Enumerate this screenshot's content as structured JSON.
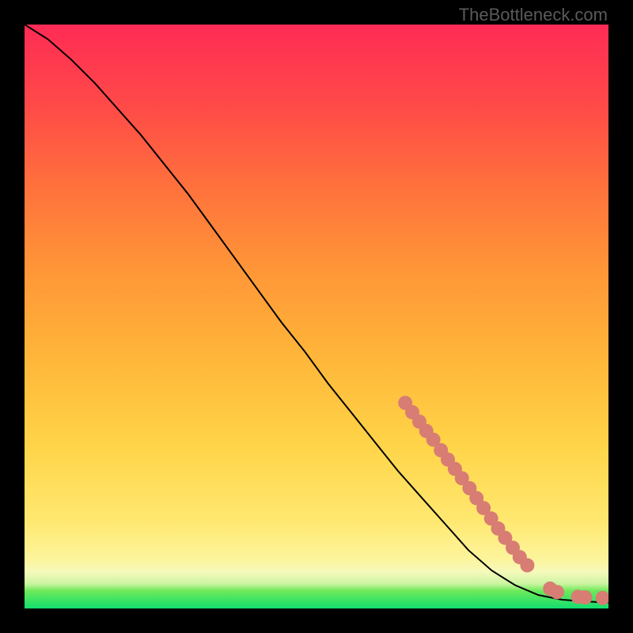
{
  "watermark": "TheBottleneck.com",
  "colors": {
    "curve": "#000000",
    "marker_fill": "#d77d74",
    "marker_stroke": "#d77d74"
  },
  "chart_data": {
    "type": "line",
    "title": "",
    "xlabel": "",
    "ylabel": "",
    "xlim": [
      0,
      100
    ],
    "ylim": [
      0,
      100
    ],
    "grid": false,
    "legend": false,
    "series": [
      {
        "name": "curve",
        "x": [
          0,
          4,
          8,
          12,
          16,
          20,
          24,
          28,
          32,
          36,
          40,
          44,
          48,
          52,
          56,
          60,
          64,
          68,
          72,
          76,
          80,
          84,
          88,
          92,
          96,
          100
        ],
        "y": [
          100,
          97.5,
          94,
          90,
          85.5,
          81,
          76,
          71,
          65.5,
          60,
          54.5,
          49,
          44,
          38.5,
          33.5,
          28.5,
          23.5,
          19,
          14.5,
          10,
          6.5,
          4,
          2.3,
          1.5,
          1.2,
          1
        ],
        "style": "solid"
      }
    ],
    "markers": [
      {
        "x": 65.2,
        "y": 35.2
      },
      {
        "x": 66.4,
        "y": 33.6
      },
      {
        "x": 67.6,
        "y": 32.0
      },
      {
        "x": 68.8,
        "y": 30.4
      },
      {
        "x": 70.0,
        "y": 28.9
      },
      {
        "x": 71.3,
        "y": 27.1
      },
      {
        "x": 72.5,
        "y": 25.5
      },
      {
        "x": 73.7,
        "y": 23.9
      },
      {
        "x": 74.9,
        "y": 22.3
      },
      {
        "x": 76.2,
        "y": 20.6
      },
      {
        "x": 77.4,
        "y": 18.9
      },
      {
        "x": 78.6,
        "y": 17.2
      },
      {
        "x": 79.9,
        "y": 15.4
      },
      {
        "x": 81.1,
        "y": 13.7
      },
      {
        "x": 82.3,
        "y": 12.1
      },
      {
        "x": 83.6,
        "y": 10.4
      },
      {
        "x": 84.8,
        "y": 8.8
      },
      {
        "x": 86.1,
        "y": 7.4
      },
      {
        "x": 90.0,
        "y": 3.4
      },
      {
        "x": 91.2,
        "y": 2.8
      },
      {
        "x": 94.8,
        "y": 2.0
      },
      {
        "x": 96.0,
        "y": 1.9
      },
      {
        "x": 99.0,
        "y": 1.8
      }
    ]
  }
}
